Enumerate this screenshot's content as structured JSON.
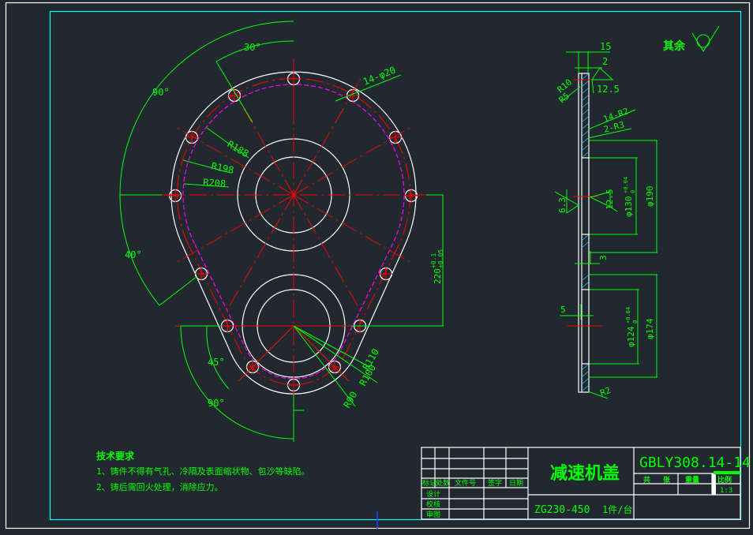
{
  "colors": {
    "background": "#212830",
    "outline": "#ffffff",
    "centerline": "#ff0000",
    "dimension": "#00ff00",
    "frame": "#00ffff",
    "hidden": "#ff00ff"
  },
  "front_view": {
    "angle_labels": [
      "30°",
      "90°",
      "40°",
      "45°",
      "90°"
    ],
    "radius_labels": [
      "R188",
      "R198",
      "R208",
      "R110",
      "R100",
      "R90"
    ],
    "hole_label": "14-φ20",
    "center_distance": "220",
    "center_distance_tol_upper": "+0.1",
    "center_distance_tol_lower": "+0.05"
  },
  "side_view": {
    "surface_note_prefix": "其余",
    "dims": {
      "thickness": "15",
      "step": "2",
      "roughness_top": "12.5",
      "r10": "R10",
      "r5": "R5",
      "r2_fillets": "14-R2",
      "r3_fillets": "2-R3",
      "roughness_left": "6.3",
      "roughness_mid": "12.5",
      "bore_upper": "φ130",
      "bore_upper_tol_upper": "+0.04",
      "bore_upper_tol_lower": "0",
      "dia_upper": "φ190",
      "step_3": "3",
      "step_5": "5",
      "bore_lower": "φ124",
      "bore_lower_tol_upper": "+0.04",
      "bore_lower_tol_lower": "0",
      "dia_lower": "φ174",
      "r2_bottom": "R2"
    }
  },
  "tech_requirements": {
    "title": "技术要求",
    "items": [
      "1、铸件不得有气孔、冷隔及表面缩状物、包沙等缺陷。",
      "2、铸后需回火处理，消除应力。"
    ]
  },
  "title_block": {
    "part_name": "减速机盖",
    "drawing_no": "GBLY308.14-14",
    "material": "ZG230-450",
    "quantity": "1件/台",
    "header_labels": [
      "标记",
      "处数",
      "文件号",
      "签字",
      "日期"
    ],
    "role_labels": [
      "设计",
      "校核",
      "审图"
    ],
    "right_labels": [
      "共",
      "张",
      "重量",
      "比例"
    ],
    "scale": "1:3"
  }
}
